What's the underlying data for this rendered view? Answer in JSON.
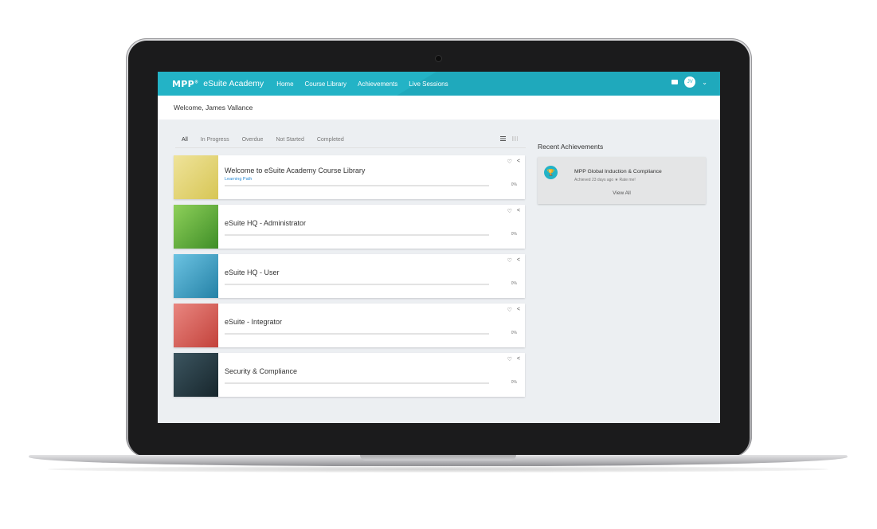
{
  "nav": {
    "logo": "MPP",
    "brand": "eSuite Academy",
    "links": [
      "Home",
      "Course Library",
      "Achievements",
      "Live Sessions"
    ],
    "avatar_initials": "JV"
  },
  "welcome": "Welcome, James Vallance",
  "tabs": [
    "All",
    "In Progress",
    "Overdue",
    "Not Started",
    "Completed"
  ],
  "courses": [
    {
      "title": "Welcome to eSuite Academy Course Library",
      "subtitle": "Learning Path",
      "progress": "0%",
      "thumb_color": "#e8d86a"
    },
    {
      "title": "eSuite HQ - Administrator",
      "subtitle": "",
      "progress": "0%",
      "thumb_color": "#6fbf3a"
    },
    {
      "title": "eSuite HQ - User",
      "subtitle": "",
      "progress": "0%",
      "thumb_color": "#3aa7cf"
    },
    {
      "title": "eSuite - Integrator",
      "subtitle": "",
      "progress": "0%",
      "thumb_color": "#d9564f"
    },
    {
      "title": "Security & Compliance",
      "subtitle": "",
      "progress": "0%",
      "thumb_color": "#2a3e45"
    }
  ],
  "achievements": {
    "heading": "Recent Achievements",
    "item_name": "MPP Global Induction & Compliance",
    "item_meta": "Achieved 23 days ago ★ Rate me!",
    "view_all": "View All"
  },
  "colors": {
    "accent": "#23b3c6",
    "link": "#2a8cd6"
  }
}
